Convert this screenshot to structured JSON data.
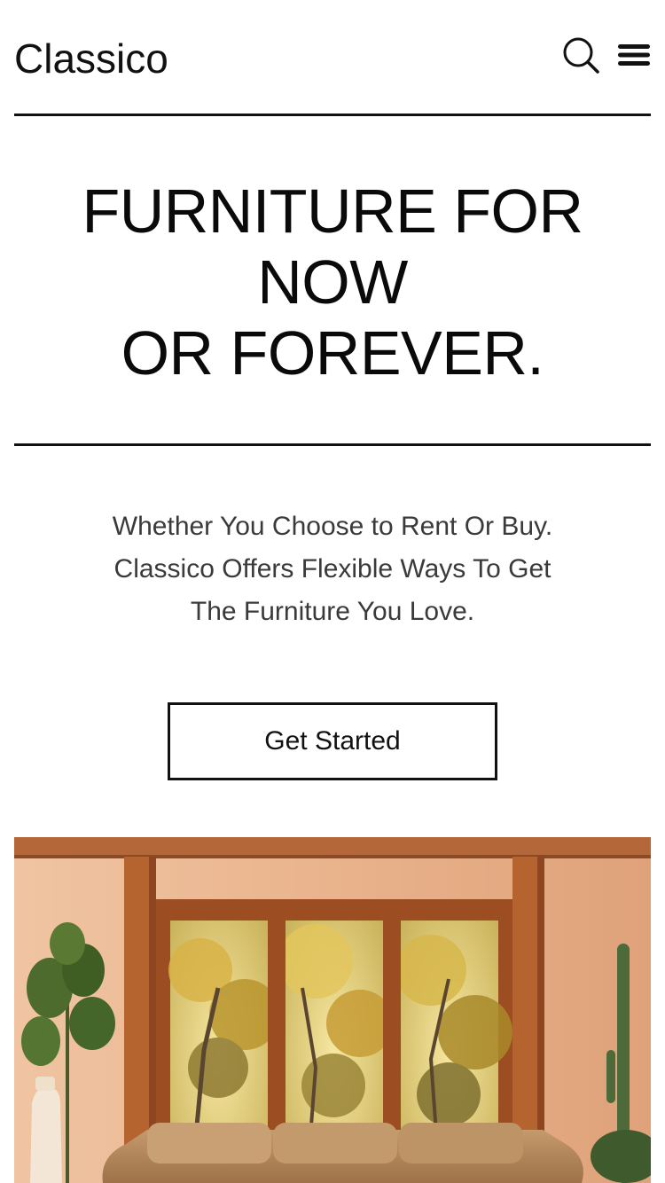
{
  "header": {
    "logo": "Classico",
    "search_icon": "search-icon",
    "menu_icon": "hamburger-menu-icon"
  },
  "hero": {
    "title_lines": [
      "FURNITURE FOR",
      "NOW",
      "OR FOREVER."
    ],
    "subtitle_lines": [
      "Whether You Choose to Rent Or Buy.",
      "Classico Offers Flexible Ways To Get",
      "The Furniture You Love."
    ],
    "cta_label": "Get Started"
  },
  "colors": {
    "text": "#111111",
    "subtext": "#3a3a3a",
    "background": "#ffffff",
    "wall": "#e9b48d",
    "wood": "#a2542a",
    "sofa": "#b98a5d"
  }
}
